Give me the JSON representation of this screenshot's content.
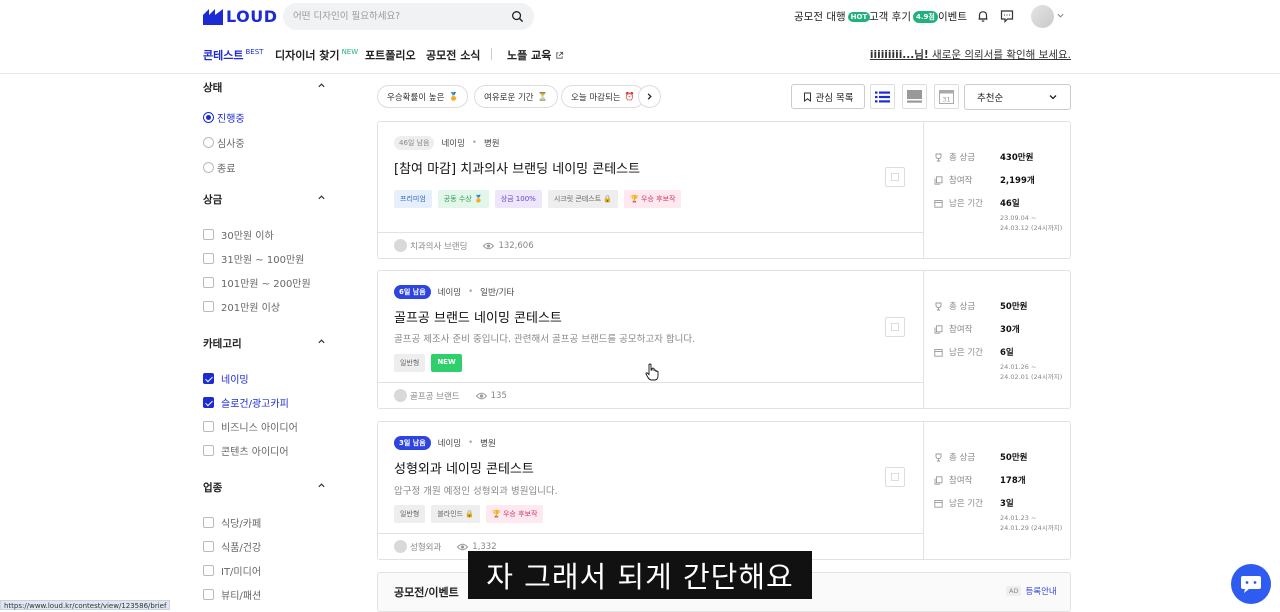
{
  "brand": {
    "name": "LOUD",
    "color": "#1d2bd6"
  },
  "search": {
    "placeholder": "어떤 디자인이 필요하세요?"
  },
  "topnav": {
    "agency": {
      "label": "공모전 대행",
      "badge": "HOT"
    },
    "reviews": {
      "label": "고객 후기",
      "badge": "4.9점"
    },
    "events": {
      "label": "이벤트"
    },
    "icons": [
      "bell-icon",
      "message-icon",
      "avatar",
      "chevron-down-icon"
    ]
  },
  "subnav": {
    "items": [
      {
        "label": "콘테스트",
        "sup": "BEST"
      },
      {
        "label": "디자이너 찾기",
        "sup": "NEW"
      },
      {
        "label": "포트폴리오"
      },
      {
        "label": "공모전 소식"
      },
      {
        "label": "노플 교육"
      }
    ],
    "message_user": "iiiiiiiii...님!",
    "message_text": " 새로운 의뢰서를 확인해 보세요."
  },
  "sidebar": {
    "status": {
      "title": "상태",
      "options": [
        "진행중",
        "심사중",
        "종료"
      ],
      "selected": "진행중"
    },
    "prize": {
      "title": "상금",
      "options": [
        "30만원 이하",
        "31만원 ~ 100만원",
        "101만원 ~ 200만원",
        "201만원 이상"
      ]
    },
    "category": {
      "title": "카테고리",
      "options": [
        "네이밍",
        "슬로건/광고카피",
        "비즈니스 아이디어",
        "콘텐츠 아이디어"
      ],
      "checked": [
        "네이밍",
        "슬로건/광고카피"
      ]
    },
    "industry": {
      "title": "업종",
      "options": [
        "식당/카페",
        "식품/건강",
        "IT/미디어",
        "뷰티/패션"
      ]
    }
  },
  "filters": {
    "chips": [
      {
        "label": "우승확률이 높은",
        "emoji": "🏅"
      },
      {
        "label": "여유로운 기간",
        "emoji": "⏳"
      },
      {
        "label": "오늘 마감되는",
        "emoji": "⏰"
      }
    ],
    "fav_label": "관심 목록",
    "sort_label": "추천순"
  },
  "cards": [
    {
      "dday": "46일 남음",
      "category": "네이밍",
      "industry": "병원",
      "title": "[참여 마감] 치과의사 브랜딩 네이밍 콘테스트",
      "desc": "",
      "tags": [
        "프리미엄",
        "공동 수상 🏅",
        "상금 100%",
        "시크릿 콘테스트 🔒",
        "🏆 우승 후보작"
      ],
      "owner": "치과의사 브랜딩",
      "views": "132,606",
      "prize_label": "총 상금",
      "prize": "430만원",
      "entries_label": "참여작",
      "entries": "2,199개",
      "remain_label": "남은 기간",
      "remain": "46일",
      "date_start": "23.09.04 ~",
      "date_end": "24.03.12 (24시까지)"
    },
    {
      "dday": "6일 남음",
      "category": "네이밍",
      "industry": "일반/기타",
      "title": "골프공 브랜드 네이밍 콘테스트",
      "desc": "골프공 제조사 준비 중입니다. 관련해서 골프공 브랜드를 공모하고자 합니다.",
      "tags": [
        "일반형",
        "NEW"
      ],
      "owner": "골프공 브랜드",
      "views": "135",
      "prize_label": "총 상금",
      "prize": "50만원",
      "entries_label": "참여작",
      "entries": "30개",
      "remain_label": "남은 기간",
      "remain": "6일",
      "date_start": "24.01.26 ~",
      "date_end": "24.02.01 (24시까지)"
    },
    {
      "dday": "3일 남음",
      "category": "네이밍",
      "industry": "병원",
      "title": "성형외과 네이밍 콘테스트",
      "desc": "압구정 개원 예정인 성형외과 병원입니다.",
      "tags": [
        "일반형",
        "블라인드 🔒",
        "🏆 우승 후보작"
      ],
      "owner": "성형외과",
      "views": "1,332",
      "prize_label": "총 상금",
      "prize": "50만원",
      "entries_label": "참여작",
      "entries": "178개",
      "remain_label": "남은 기간",
      "remain": "3일",
      "date_start": "24.01.23 ~",
      "date_end": "24.01.29 (24시까지)"
    }
  ],
  "bottom_card": {
    "label": "공모전/이벤트",
    "ad_badge": "AD",
    "ad_text": "등록안내"
  },
  "subtitle": "자 그래서 되게 간단해요",
  "status_url": "https://www.loud.kr/contest/view/123586/brief"
}
